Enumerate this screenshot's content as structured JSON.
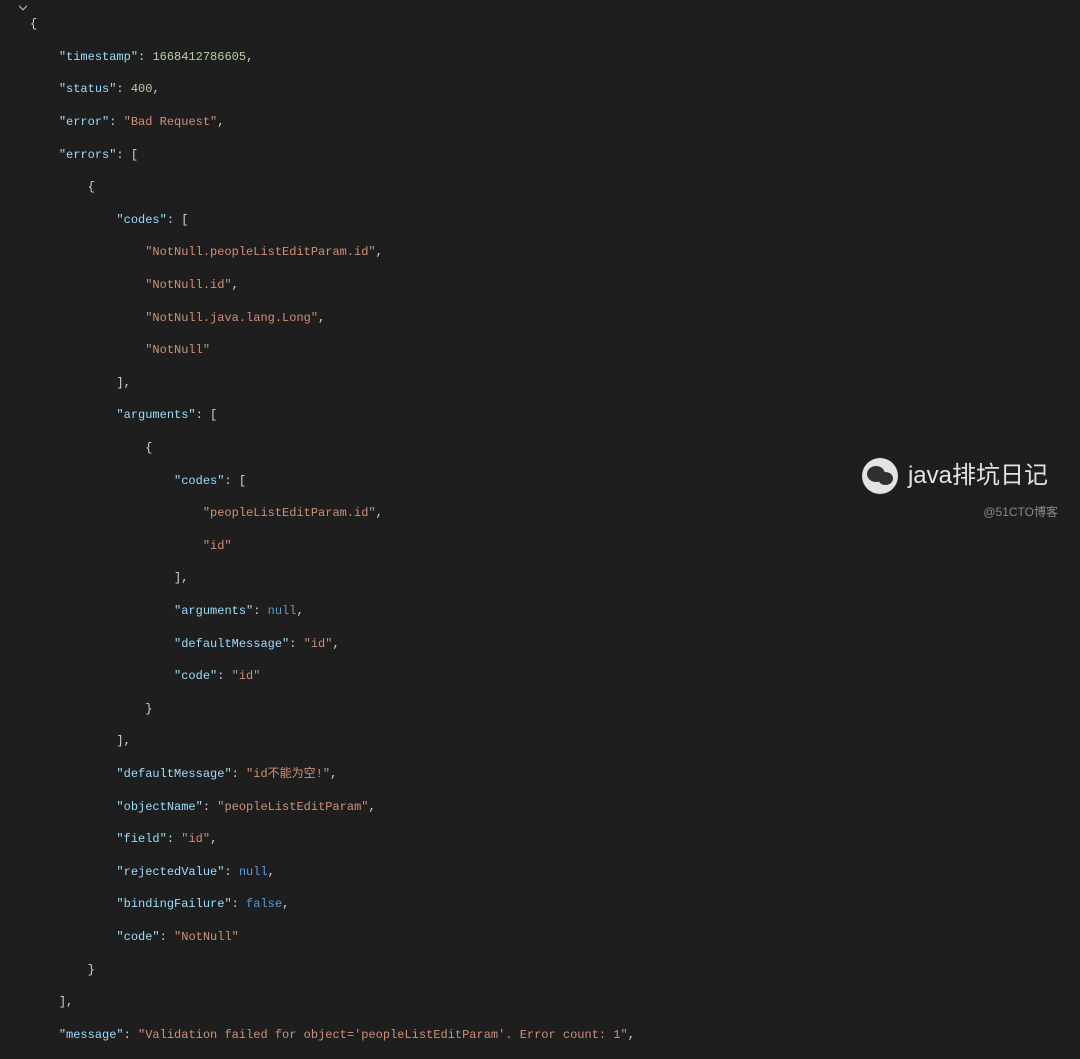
{
  "json_response": {
    "timestamp": 1668412786605,
    "status": 400,
    "error": "Bad Request",
    "errors": [
      {
        "codes": [
          "NotNull.peopleListEditParam.id",
          "NotNull.id",
          "NotNull.java.lang.Long",
          "NotNull"
        ],
        "arguments": [
          {
            "codes": [
              "peopleListEditParam.id",
              "id"
            ],
            "arguments": null,
            "defaultMessage": "id",
            "code": "id"
          }
        ],
        "defaultMessage": "id不能为空!",
        "objectName": "peopleListEditParam",
        "field": "id",
        "rejectedValue": null,
        "bindingFailure": false,
        "code": "NotNull"
      }
    ],
    "message": "Validation failed for object='peopleListEditParam'. Error count: 1"
  },
  "tokens": {
    "brace_open": "{",
    "brace_close": "}",
    "bracket_open": "[",
    "bracket_close": "]",
    "comma": ",",
    "colon_space": ": ",
    "null_str": "null",
    "false_str": "false",
    "k_timestamp": "\"timestamp\"",
    "k_status": "\"status\"",
    "k_error": "\"error\"",
    "k_errors": "\"errors\"",
    "k_codes": "\"codes\"",
    "k_arguments": "\"arguments\"",
    "k_defaultMessage": "\"defaultMessage\"",
    "k_code": "\"code\"",
    "k_objectName": "\"objectName\"",
    "k_field": "\"field\"",
    "k_rejectedValue": "\"rejectedValue\"",
    "k_bindingFailure": "\"bindingFailure\"",
    "k_message": "\"message\"",
    "v_timestamp": "1668412786605",
    "v_status": "400",
    "v_error": "\"Bad Request\"",
    "v_code0": "\"NotNull.peopleListEditParam.id\"",
    "v_code1": "\"NotNull.id\"",
    "v_code2": "\"NotNull.java.lang.Long\"",
    "v_code3": "\"NotNull\"",
    "v_icode0": "\"peopleListEditParam.id\"",
    "v_icode1": "\"id\"",
    "v_defmsg_inner": "\"id\"",
    "v_code_inner": "\"id\"",
    "v_defmsg_outer": "\"id不能为空!\"",
    "v_objname": "\"peopleListEditParam\"",
    "v_field": "\"id\"",
    "v_code_outer": "\"NotNull\"",
    "v_message": "\"Validation failed for object='peopleListEditParam'. Error count: 1\""
  },
  "watermark": {
    "text": "java排坑日记",
    "signature": "@51CTO博客"
  }
}
